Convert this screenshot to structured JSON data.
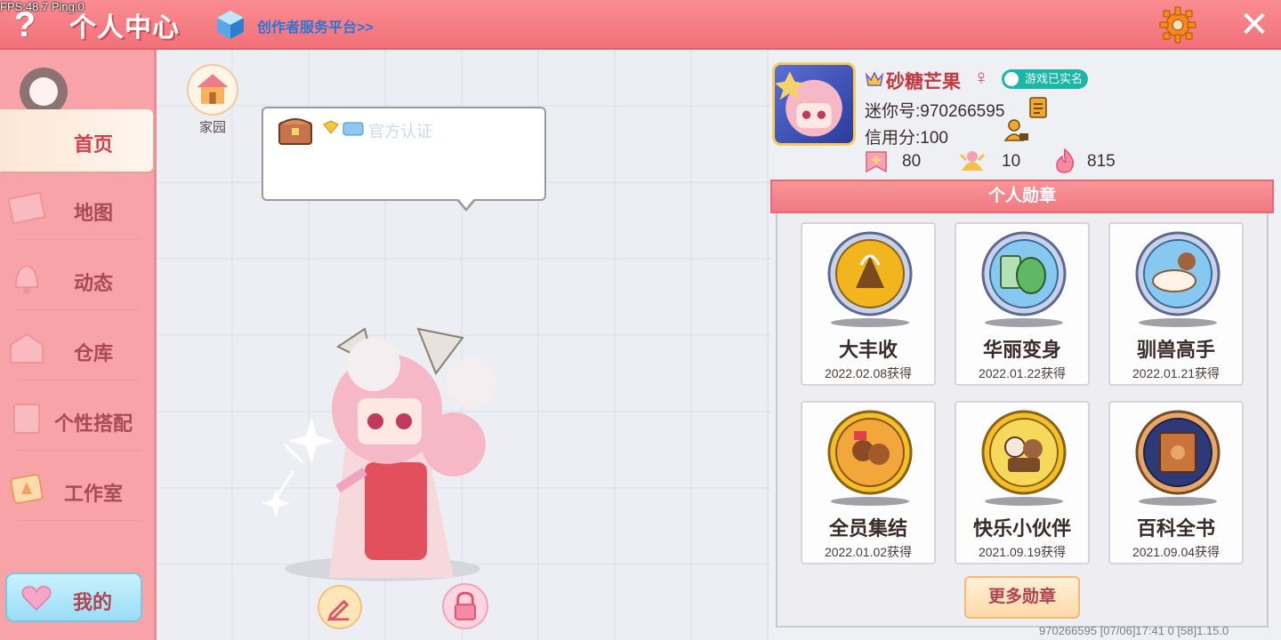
{
  "debug": {
    "fps": "FPS:48.7",
    "ping": "Ping:0"
  },
  "header": {
    "help_label": "?",
    "title": "个人中心",
    "creator_link": "创作者服务平台>>",
    "close_label": "✕"
  },
  "sidebar": {
    "items": [
      {
        "label": "首页",
        "icon": "home-tab-icon",
        "active": true
      },
      {
        "label": "地图",
        "icon": "map-icon",
        "active": false
      },
      {
        "label": "动态",
        "icon": "bell-icon",
        "active": false
      },
      {
        "label": "仓库",
        "icon": "warehouse-icon",
        "active": false
      },
      {
        "label": "个性搭配",
        "icon": "outfit-icon",
        "active": false
      },
      {
        "label": "工作室",
        "icon": "studio-icon",
        "active": false
      }
    ],
    "mine_label": "我的"
  },
  "center": {
    "home_label": "家园",
    "bubble_cert_text": "官方认证"
  },
  "profile": {
    "nickname": "砂糖芒果",
    "gender_symbol": "♀",
    "realname_badge": "游戏已实名",
    "mini_id": "迷你号:970266595",
    "credit": "信用分:100",
    "stats": [
      {
        "icon": "plus-badge-icon",
        "value": "80"
      },
      {
        "icon": "fans-icon",
        "value": "10"
      },
      {
        "icon": "flame-icon",
        "value": "815"
      }
    ]
  },
  "medals": {
    "header": "个人勋章",
    "items": [
      {
        "name": "大丰收",
        "date": "2022.02.08获得",
        "tier": "silver",
        "icon": "harvest-medal-icon"
      },
      {
        "name": "华丽变身",
        "date": "2022.01.22获得",
        "tier": "silver",
        "icon": "transform-medal-icon"
      },
      {
        "name": "驯兽高手",
        "date": "2022.01.21获得",
        "tier": "silver",
        "icon": "tamer-medal-icon"
      },
      {
        "name": "全员集结",
        "date": "2022.01.02获得",
        "tier": "gold",
        "icon": "assemble-medal-icon"
      },
      {
        "name": "快乐小伙伴",
        "date": "2021.09.19获得",
        "tier": "gold",
        "icon": "friends-medal-icon"
      },
      {
        "name": "百科全书",
        "date": "2021.09.04获得",
        "tier": "bronze",
        "icon": "encyclopedia-medal-icon"
      }
    ],
    "more_label": "更多勋章"
  },
  "footer": {
    "info": "970266595   [07/06]17:41 0   [58]1.15.0"
  },
  "colors": {
    "accent": "#f27178",
    "gold": "#f2b51e",
    "silver": "#b9c4dc",
    "bronze": "#d98a4c"
  }
}
